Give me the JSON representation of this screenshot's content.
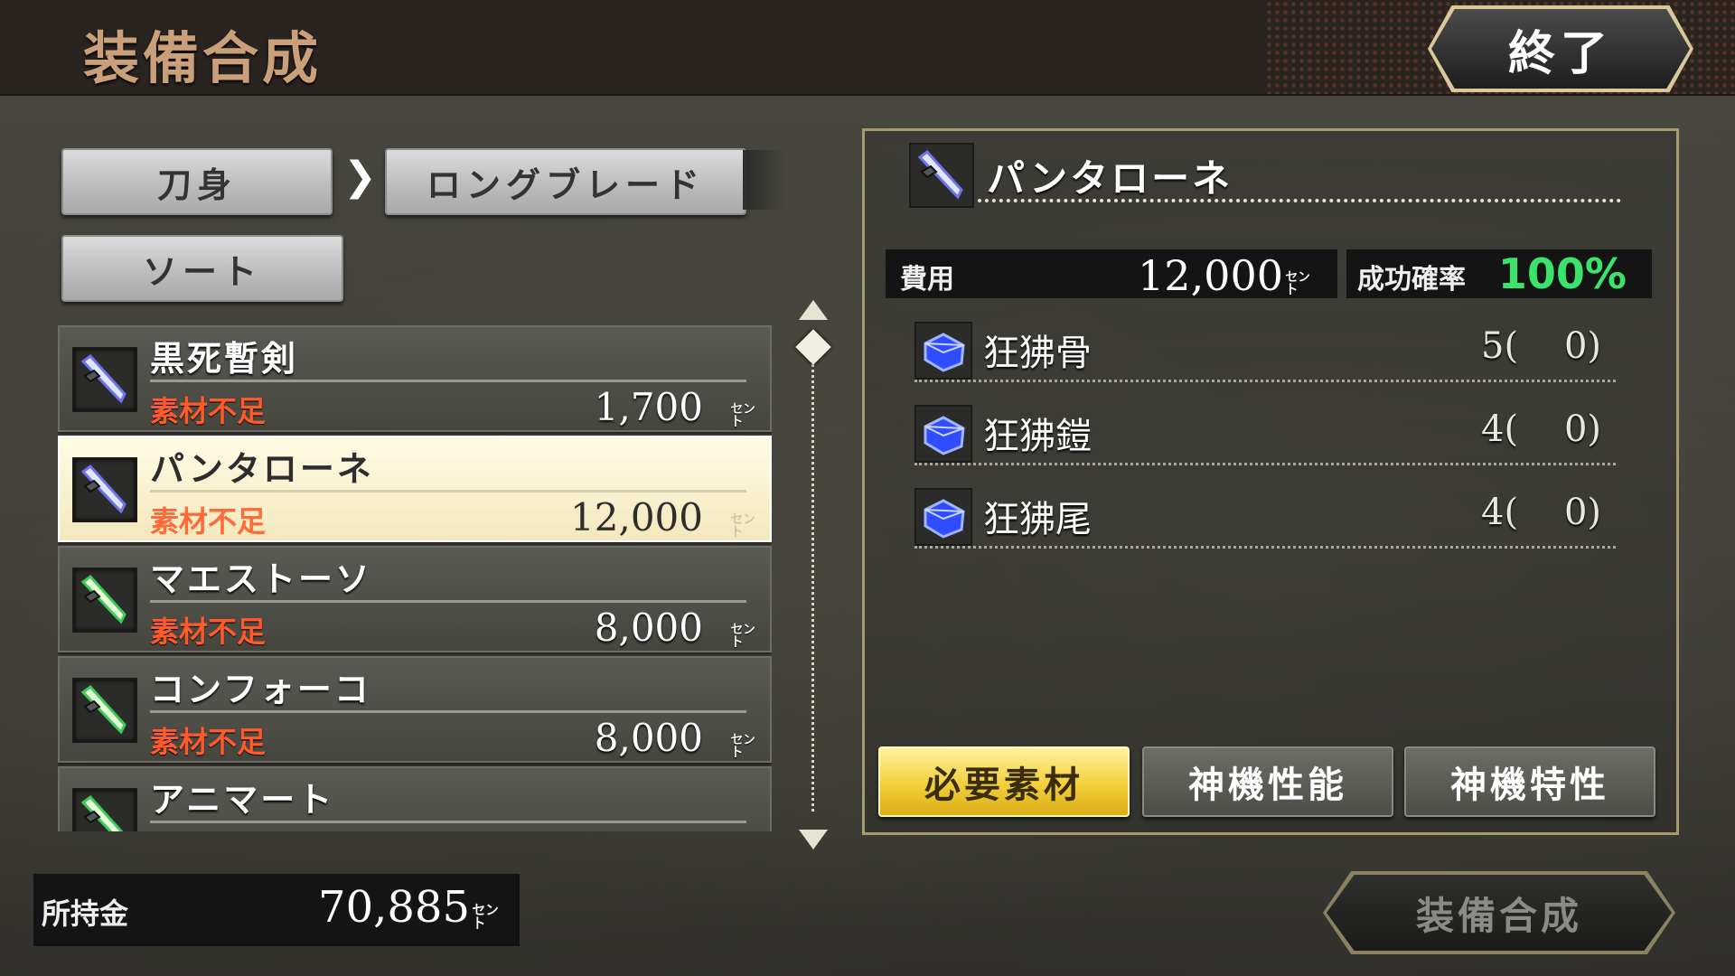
{
  "header": {
    "title": "装備合成",
    "end_label": "終了"
  },
  "filters": {
    "category": "刀身",
    "subcategory": "ロングブレード",
    "sort": "ソート"
  },
  "list": {
    "items": [
      {
        "name": "黒死暫剣",
        "status": "素材不足",
        "price": "1,700",
        "unit": "㌣",
        "icon": "blade-blue-icon",
        "selected": false
      },
      {
        "name": "パンタローネ",
        "status": "素材不足",
        "price": "12,000",
        "unit": "㌣",
        "icon": "blade-blue-icon",
        "selected": true
      },
      {
        "name": "マエストーソ",
        "status": "素材不足",
        "price": "8,000",
        "unit": "㌣",
        "icon": "blade-green-icon",
        "selected": false
      },
      {
        "name": "コンフォーコ",
        "status": "素材不足",
        "price": "8,000",
        "unit": "㌣",
        "icon": "blade-green-icon",
        "selected": false
      },
      {
        "name": "アニマート",
        "status": "",
        "price": "",
        "unit": "",
        "icon": "blade-green-icon",
        "selected": false
      }
    ]
  },
  "money": {
    "label": "所持金",
    "value": "70,885",
    "unit": "㌣"
  },
  "detail": {
    "name": "パンタローネ",
    "cost_label": "費用",
    "cost_value": "12,000",
    "cost_unit": "㌣",
    "rate_label": "成功確率",
    "rate_value": "100%",
    "materials": [
      {
        "name": "狂狒骨",
        "count": "5(    0)",
        "icon": "material-crystal-icon"
      },
      {
        "name": "狂狒鎧",
        "count": "4(    0)",
        "icon": "material-crystal-icon"
      },
      {
        "name": "狂狒尾",
        "count": "4(    0)",
        "icon": "material-crystal-icon"
      }
    ],
    "tabs": [
      "必要素材",
      "神機性能",
      "神機特性"
    ],
    "active_tab": "必要素材"
  },
  "synth_label": "装備合成",
  "colors": {
    "accent_gold": "#f2cf3a",
    "status_red": "#ff5a2c",
    "rate_green": "#3be26c",
    "frame_gold": "#a89a6b"
  }
}
